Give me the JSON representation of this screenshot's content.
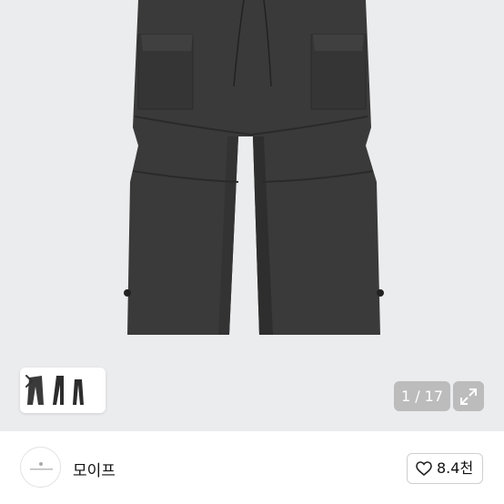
{
  "gallery": {
    "counter": "1 / 17",
    "product_image": "charcoal-cargo-parachute-pants",
    "thumbnail_icon": "pants-thumbnail-icon",
    "next_icon": "chevron-right-icon",
    "expand_icon": "expand-arrows-icon"
  },
  "seller": {
    "name": "모이프",
    "avatar_icon": "shop-logo-icon"
  },
  "like": {
    "icon": "heart-outline-icon",
    "count": "8.4천"
  },
  "colors": {
    "hero_bg": "#ebecee",
    "pants": "#3a3a3a",
    "pill_bg": "#969696"
  }
}
